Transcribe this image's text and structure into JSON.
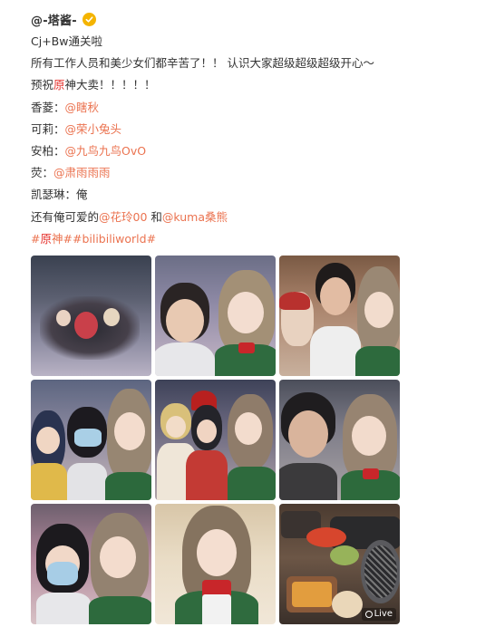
{
  "author": {
    "name": "@-塔酱-",
    "verified_color": "#f4b400"
  },
  "lines": {
    "l1": "Cj+Bw通关啦",
    "l2": "所有工作人员和美少女们都辛苦了！！ 认识大家超级超级超级开心～",
    "l3_pre": "预祝",
    "l3_hl": "原",
    "l3_post": "神大卖！！！！！",
    "l4_label": "香菱：",
    "l4_mention": "@瞎秋",
    "l5_label": "可莉：",
    "l5_mention": "@荣小兔头",
    "l6_label": "安柏：",
    "l6_mention": "@九鸟九鸟OvO",
    "l7_label": "荧：",
    "l7_mention": "@肃雨雨雨",
    "l8": "凯瑟琳：俺",
    "l9_pre": "还有俺可爱的",
    "l9_mention1": "@花玲00",
    "l9_mid": " 和",
    "l9_mention2": "@kuma桑熊",
    "l10_tag1_pre": "#",
    "l10_tag1_hl": "原",
    "l10_tag1_post": "神#",
    "l10_tag2": "#bilibiliworld#"
  },
  "photos": {
    "live_label": "Live"
  },
  "colors": {
    "link": "#eb7350",
    "highlight": "#e5322d",
    "text": "#333333"
  }
}
